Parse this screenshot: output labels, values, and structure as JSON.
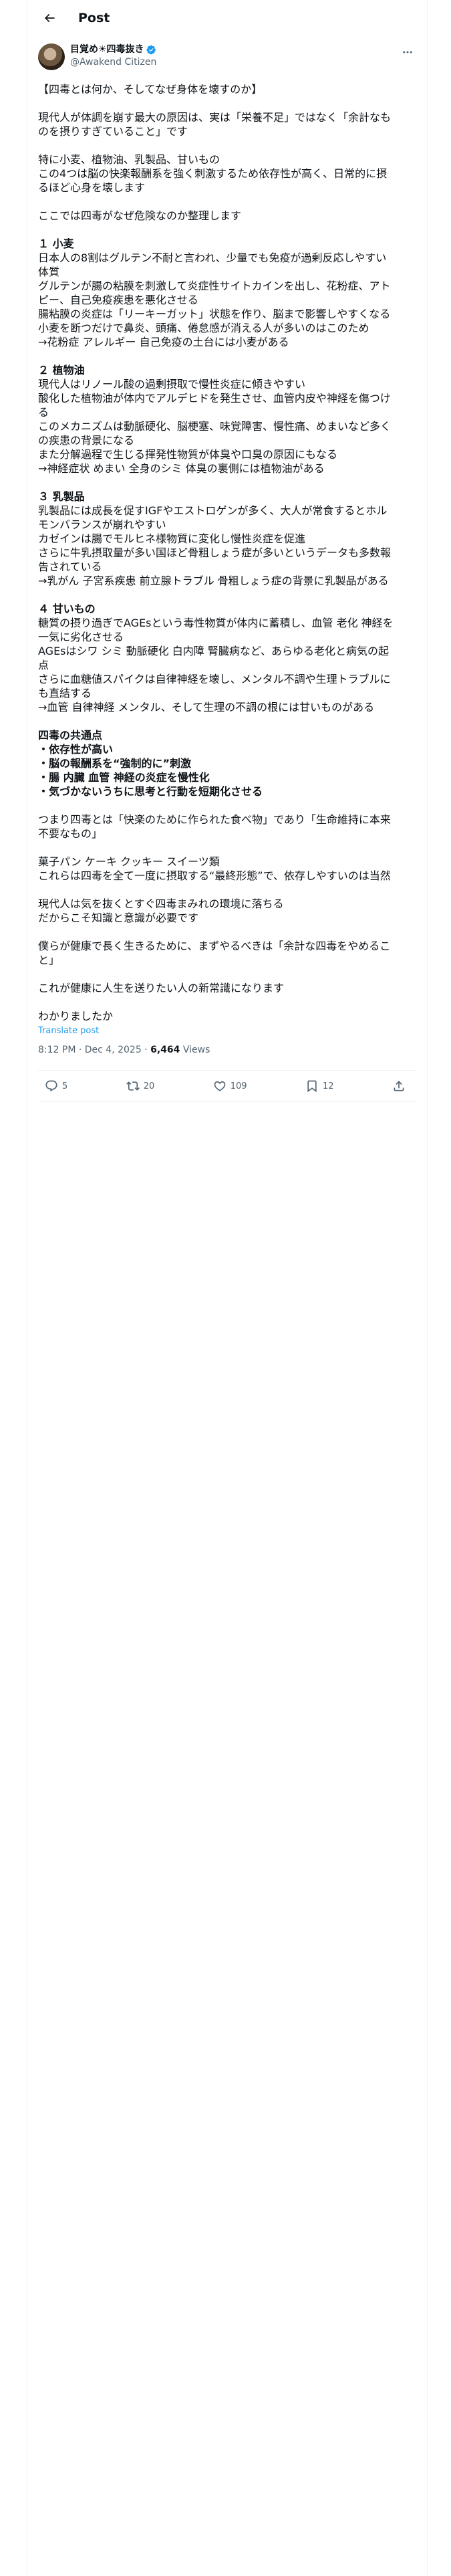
{
  "header": {
    "title": "Post"
  },
  "author": {
    "display_name": "目覚め☀︎四毒抜き",
    "handle": "@Awakend Citizen"
  },
  "post": {
    "lines": [
      {
        "text": "【四毒とは何か、そしてなぜ身体を壊すのか】"
      },
      {
        "text": ""
      },
      {
        "text": "現代人が体調を崩す最大の原因は、実は「栄養不足」ではなく「余計なも"
      },
      {
        "text": "のを摂りすぎていること」です"
      },
      {
        "text": ""
      },
      {
        "text": "特に小麦、植物油、乳製品、甘いもの"
      },
      {
        "text": "この4つは脳の快楽報酬系を強く刺激するため依存性が高く、日常的に摂"
      },
      {
        "text": "るほど心身を壊します"
      },
      {
        "text": ""
      },
      {
        "text": "ここでは四毒がなぜ危険なのか整理します"
      },
      {
        "text": ""
      },
      {
        "text": "１ 小麦",
        "bold": true
      },
      {
        "text": "日本人の8割はグルテン不耐と言われ、少量でも免疫が過剰反応しやすい"
      },
      {
        "text": "体質"
      },
      {
        "text": "グルテンが腸の粘膜を刺激して炎症性サイトカインを出し、花粉症、アト"
      },
      {
        "text": "ピー、自己免疫疾患を悪化させる"
      },
      {
        "text": "腸粘膜の炎症は「リーキーガット」状態を作り、脳まで影響しやすくなる"
      },
      {
        "text": "小麦を断つだけで鼻炎、頭痛、倦怠感が消える人が多いのはこのため"
      },
      {
        "text": "→花粉症 アレルギー 自己免疫の土台には小麦がある"
      },
      {
        "text": ""
      },
      {
        "text": "２ 植物油",
        "bold": true
      },
      {
        "text": "現代人はリノール酸の過剰摂取で慢性炎症に傾きやすい"
      },
      {
        "text": "酸化した植物油が体内でアルデヒドを発生させ、血管内皮や神経を傷つけ"
      },
      {
        "text": "る"
      },
      {
        "text": "このメカニズムは動脈硬化、脳梗塞、味覚障害、慢性痛、めまいなど多く"
      },
      {
        "text": "の疾患の背景になる"
      },
      {
        "text": "また分解過程で生じる揮発性物質が体臭や口臭の原因にもなる"
      },
      {
        "text": "→神経症状 めまい 全身のシミ 体臭の裏側には植物油がある"
      },
      {
        "text": ""
      },
      {
        "text": "３ 乳製品",
        "bold": true
      },
      {
        "text": "乳製品には成長を促すIGFやエストロゲンが多く、大人が常食するとホル"
      },
      {
        "text": "モンバランスが崩れやすい"
      },
      {
        "text": "カゼインは腸でモルヒネ様物質に変化し慢性炎症を促進"
      },
      {
        "text": "さらに牛乳摂取量が多い国ほど骨粗しょう症が多いというデータも多数報"
      },
      {
        "text": "告されている"
      },
      {
        "text": "→乳がん 子宮系疾患 前立腺トラブル 骨粗しょう症の背景に乳製品がある"
      },
      {
        "text": ""
      },
      {
        "text": "４ 甘いもの",
        "bold": true
      },
      {
        "text": "糖質の摂り過ぎでAGEsという毒性物質が体内に蓄積し、血管 老化 神経を"
      },
      {
        "text": "一気に劣化させる"
      },
      {
        "text": "AGEsはシワ シミ 動脈硬化 白内障 腎臓病など、あらゆる老化と病気の起"
      },
      {
        "text": "点"
      },
      {
        "text": "さらに血糖値スパイクは自律神経を壊し、メンタル不調や生理トラブルに"
      },
      {
        "text": "も直結する"
      },
      {
        "text": "→血管 自律神経 メンタル、そして生理の不調の根には甘いものがある"
      },
      {
        "text": ""
      },
      {
        "text": "四毒の共通点",
        "bold": true
      },
      {
        "text": "・依存性が高い",
        "bold": true
      },
      {
        "text": "・脳の報酬系を“強制的に”刺激",
        "bold": true
      },
      {
        "text": "・腸 内臓 血管 神経の炎症を慢性化",
        "bold": true
      },
      {
        "text": "・気づかないうちに思考と行動を短期化させる",
        "bold": true
      },
      {
        "text": ""
      },
      {
        "text": "つまり四毒とは「快楽のために作られた食べ物」であり「生命維持に本来"
      },
      {
        "text": "不要なもの」"
      },
      {
        "text": ""
      },
      {
        "text": "菓子パン ケーキ クッキー スイーツ類"
      },
      {
        "text": "これらは四毒を全て一度に摂取する“最終形態”で、依存しやすいのは当然"
      },
      {
        "text": ""
      },
      {
        "text": "現代人は気を抜くとすぐ四毒まみれの環境に落ちる"
      },
      {
        "text": "だからこそ知識と意識が必要です"
      },
      {
        "text": ""
      },
      {
        "text": "僕らが健康で長く生きるために、まずやるべきは「余計な四毒をやめるこ"
      },
      {
        "text": "と」"
      },
      {
        "text": ""
      },
      {
        "text": "これが健康に人生を送りたい人の新常識になります"
      },
      {
        "text": ""
      },
      {
        "text": "わかりましたか"
      }
    ],
    "translate_label": "Translate post",
    "timestamp": "8:12 PM · Dec 4, 2025 · ",
    "views_count": "6,464",
    "views_label": " Views"
  },
  "actions": {
    "replies": "5",
    "reposts": "20",
    "likes": "109",
    "bookmarks": "12"
  },
  "colors": {
    "link": "#1d9bf0",
    "verified": "#1d9bf0",
    "muted": "#536471",
    "divider": "#eff3f4"
  },
  "icons": [
    "back-arrow-icon",
    "verified-badge-icon",
    "more-icon",
    "reply-icon",
    "repost-icon",
    "like-icon",
    "bookmark-icon",
    "share-icon"
  ]
}
